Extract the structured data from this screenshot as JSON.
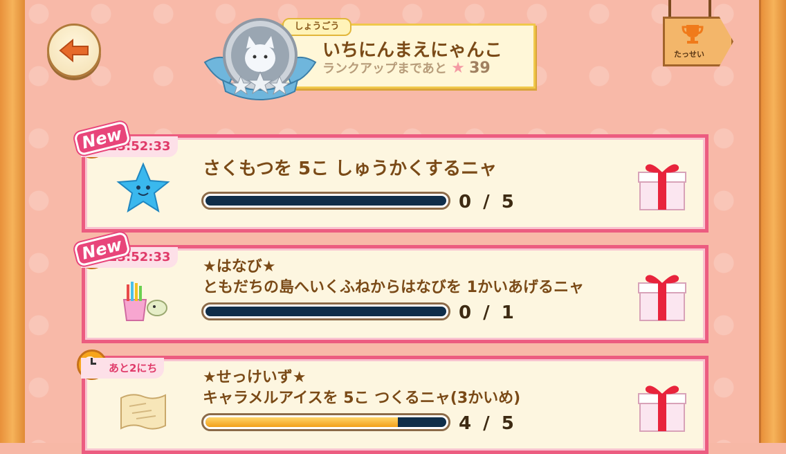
{
  "header": {
    "title_tag": "しょうごう",
    "title_name": "いちにんまえにゃんこ",
    "rank_up_text": "ランクアップまであと",
    "rank_up_star": "★",
    "rank_up_count": "39",
    "achievement_label": "たっせい"
  },
  "missions": [
    {
      "badge": "New",
      "timer": "23:52:33",
      "title_line1": "さくもつを 5こ しゅうかくするニャ",
      "title_line2": "",
      "progress_text": "0 / 5",
      "progress_value": 0,
      "progress_max": 5,
      "icon": "blue-star-icon"
    },
    {
      "badge": "New",
      "timer": "23:52:33",
      "title_line1": "★はなび★",
      "title_line2": "ともだちの島へいくふねからはなびを 1かいあげるニャ",
      "progress_text": "0 / 1",
      "progress_value": 0,
      "progress_max": 1,
      "icon": "fireworks-bucket-icon"
    },
    {
      "badge": "",
      "timer": "あと2にち",
      "title_line1": "★せっけいず★",
      "title_line2": "キャラメルアイスを 5こ つくるニャ(3かいめ)",
      "progress_text": "4 / 5",
      "progress_value": 4,
      "progress_max": 5,
      "icon": "blueprint-scroll-icon"
    }
  ],
  "colors": {
    "card_border": "#ec5c80",
    "card_bg": "#fdf6e0",
    "bar_fill": "#f2a01a",
    "bar_track": "#0f2e4a"
  }
}
